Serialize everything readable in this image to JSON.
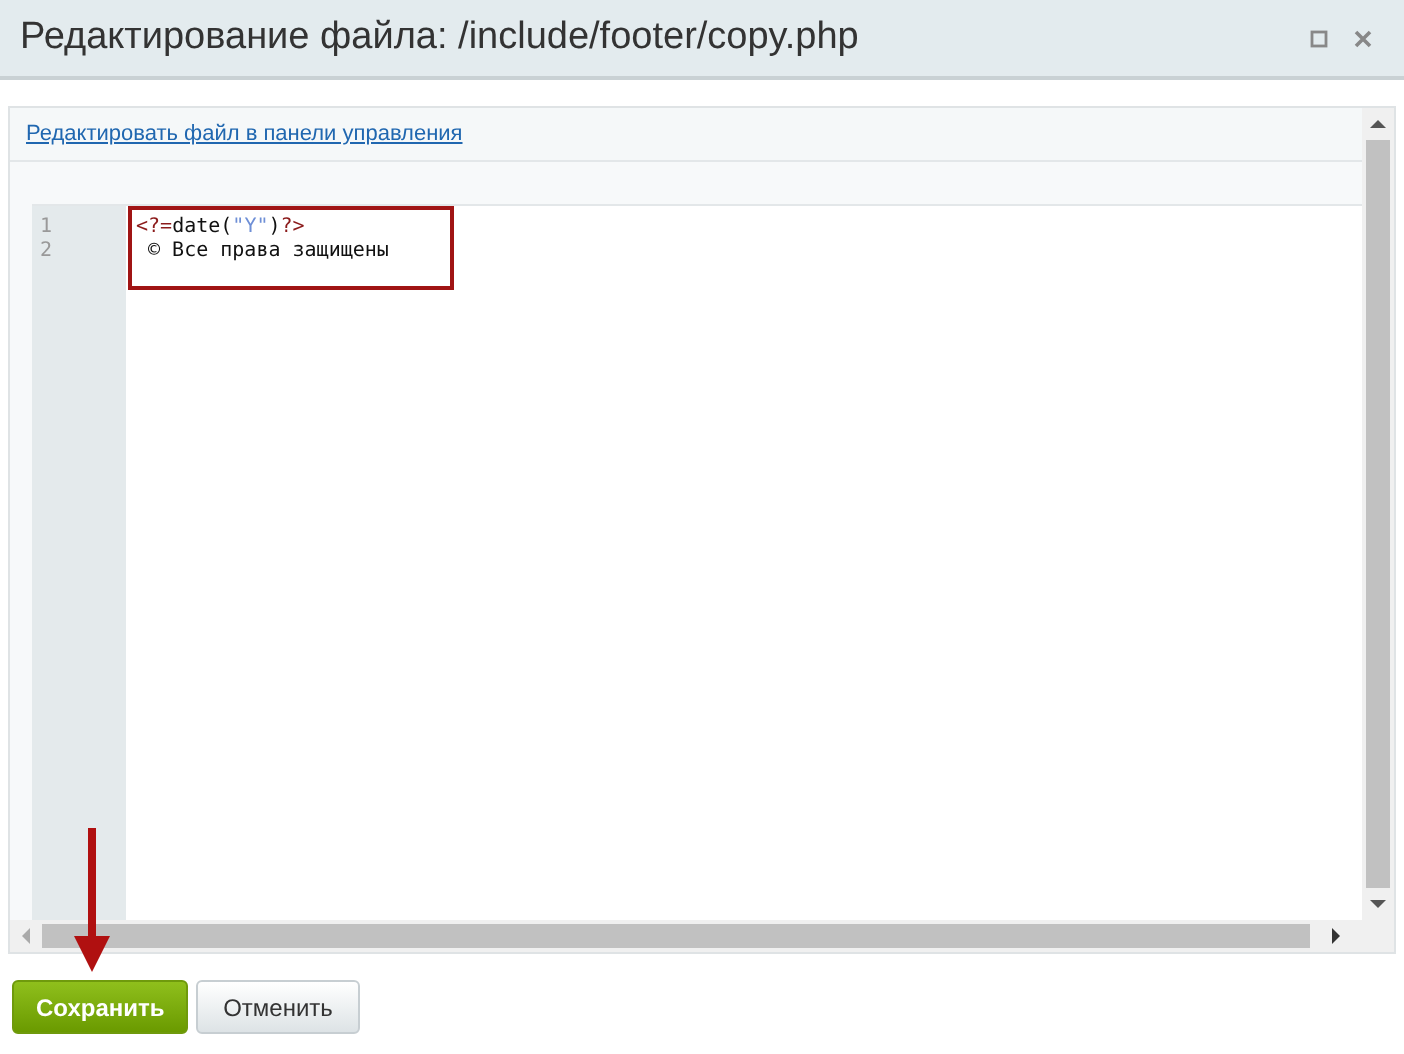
{
  "window": {
    "title": "Редактирование файла: /include/footer/copy.php"
  },
  "link": "Редактировать файл в панели управления",
  "editor": {
    "lines": [
      {
        "number": "1",
        "tokens": [
          {
            "kind": "tag",
            "text": "<?="
          },
          {
            "kind": "plain",
            "text": "date("
          },
          {
            "kind": "string",
            "text": "\"Y\""
          },
          {
            "kind": "plain",
            "text": ")"
          },
          {
            "kind": "tag",
            "text": "?>"
          }
        ]
      },
      {
        "number": "2",
        "tokens": [
          {
            "kind": "plain",
            "text": " © Все права защищены"
          }
        ]
      }
    ]
  },
  "buttons": [
    {
      "label": "Сохранить",
      "kind": "primary"
    },
    {
      "label": "Отменить",
      "kind": "secondary"
    }
  ]
}
